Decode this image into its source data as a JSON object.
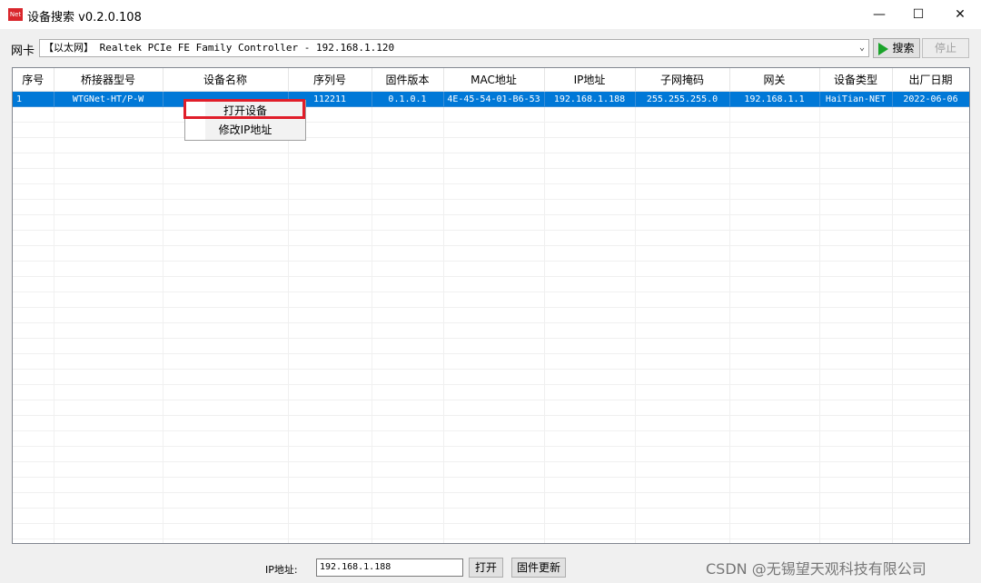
{
  "window": {
    "title": "设备搜索 v0.2.0.108",
    "icon_text": "Net",
    "minimize_symbol": "—",
    "maximize_symbol": "☐",
    "close_symbol": "✕"
  },
  "nic": {
    "label": "网卡",
    "selected": "【以太网】 Realtek PCIe FE Family Controller - 192.168.1.120",
    "caret": "⌄"
  },
  "toolbar": {
    "search_label": "搜索",
    "stop_label": "停止"
  },
  "table": {
    "columns": [
      "序号",
      "桥接器型号",
      "设备名称",
      "序列号",
      "固件版本",
      "MAC地址",
      "IP地址",
      "子网掩码",
      "网关",
      "设备类型",
      "出厂日期"
    ],
    "rows": [
      [
        "1",
        "WTGNet-HT/P-W",
        "",
        "112211",
        "0.1.0.1",
        "4E-45-54-01-B6-53",
        "192.168.1.188",
        "255.255.255.0",
        "192.168.1.1",
        "HaiTian-NET",
        "2022-06-06"
      ]
    ]
  },
  "context_menu": {
    "items": [
      "打开设备",
      "修改IP地址"
    ],
    "highlight_color": "#e01e2a"
  },
  "footer": {
    "ip_label": "IP地址:",
    "ip_value": "192.168.1.188",
    "open_label": "打开",
    "firmware_label": "固件更新"
  },
  "watermark": "CSDN @无锡望天观科技有限公司",
  "colors": {
    "selection": "#0078d7",
    "icon": "#d9262c",
    "play": "#1aa32a"
  }
}
